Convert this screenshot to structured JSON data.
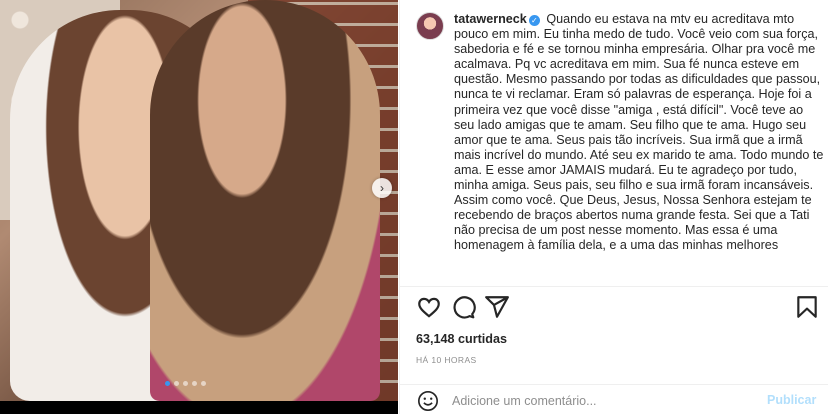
{
  "post": {
    "username": "tatawerneck",
    "verified_icon": "verified-badge-icon",
    "caption": "Quando eu estava na mtv eu acreditava mto pouco em mim. Eu tinha medo de tudo. Você veio com sua força, sabedoria e fé e se tornou minha empresária. Olhar pra você me acalmava. Pq vc acreditava em mim. Sua fé nunca esteve em questão. Mesmo passando por todas as dificuldades que passou, nunca te vi reclamar. Eram só palavras de esperança. Hoje foi a primeira vez que você disse \"amiga , está difícil\". Você teve ao seu lado amigas que te amam. Seu filho que te ama. Hugo seu amor que te ama. Seus pais tão incríveis. Sua irmã que a irmã mais incrível do mundo. Até seu ex marido te ama. Todo mundo te ama. E esse amor JAMAIS mudará. Eu te agradeço por tudo, minha amiga. Seus pais, seu filho e sua irmã foram incansáveis. Assim como você. Que Deus, Jesus, Nossa Senhora estejam te recebendo de braços abertos numa grande festa. Sei que a Tati não precisa de um post nesse momento. Mas essa é uma homenagem à família dela, e a uma das minhas melhores"
  },
  "carousel": {
    "dot_count": 5,
    "active_index": 0,
    "next_icon": "chevron-right-icon",
    "next_glyph": "›"
  },
  "actions": {
    "like_icon": "heart-icon",
    "comment_icon": "comment-icon",
    "share_icon": "send-icon",
    "save_icon": "bookmark-icon"
  },
  "likes_text": "63,148 curtidas",
  "time_text": "HÁ 10 HORAS",
  "comment": {
    "placeholder": "Adicione um comentário...",
    "publish_label": "Publicar",
    "emoji_icon": "smiley-icon"
  },
  "colors": {
    "accent": "#3897f0",
    "publish_disabled": "#b2dffc",
    "muted": "#8e8e8e"
  }
}
